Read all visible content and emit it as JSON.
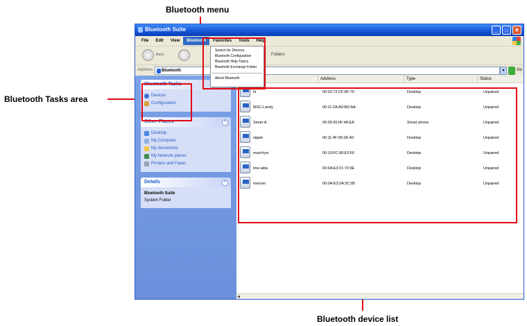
{
  "callouts": {
    "menu": "Bluetooth menu",
    "tasks": "Bluetooth Tasks area",
    "list": "Bluetooth device list"
  },
  "window": {
    "title": "Bluetooth Suite",
    "title_buttons": [
      "_",
      "□",
      "✕"
    ]
  },
  "menubar": {
    "items": [
      "File",
      "Edit",
      "View",
      "Bluetooth",
      "Favorites",
      "Tools",
      "Help"
    ],
    "active_index": 3
  },
  "toolbar": {
    "back_label": "Back",
    "folders_label": "Folders"
  },
  "address": {
    "label": "Address",
    "value": "Bluetooth",
    "go_label": "Go"
  },
  "dropdown": {
    "items": [
      "Search for Devices",
      "Bluetooth Configuration",
      "Bluetooth Help Topics",
      "Bluetooth Exchange Folder"
    ],
    "footer": "About Bluetooth"
  },
  "tasks_panel": {
    "title": "Bluetooth Tasks",
    "links": [
      "Devices",
      "Configuration"
    ]
  },
  "places_panel": {
    "title": "Other Places",
    "links": [
      "Desktop",
      "My Computer",
      "My documents",
      "My Network places",
      "Printers and Faxes"
    ]
  },
  "details_panel": {
    "title": "Details",
    "lines": [
      "Bluetooth Suite",
      "System Folder"
    ]
  },
  "list": {
    "columns": [
      "Name",
      "Address",
      "Type",
      "Status"
    ],
    "rows": [
      {
        "name": "hi",
        "address": "00:02:72:CF:8F:70",
        "type": "Desktop",
        "status": "Unpaired"
      },
      {
        "name": "MSC-Landy",
        "address": "00:11:2A:A0:BD:AA",
        "type": "Desktop",
        "status": "Unpaired"
      },
      {
        "name": "Smart A",
        "address": "00:05:95:0F:48:EA",
        "type": "Smart phone",
        "status": "Unpaired"
      },
      {
        "name": "sippie",
        "address": "00:11:4F:90:2E:A2",
        "type": "Desktop",
        "status": "Unpaired"
      },
      {
        "name": "marchysr",
        "address": "00:19:5C:90:E3:50",
        "type": "Desktop",
        "status": "Unpaired"
      },
      {
        "name": "ime-alda",
        "address": "00:0A:E3:21:70:9E",
        "type": "Desktop",
        "status": "Unpaired"
      },
      {
        "name": "mercier",
        "address": "00:0A:E3:2A:3C:80",
        "type": "Desktop",
        "status": "Unpaired"
      }
    ]
  },
  "colors": {
    "callout_red": "#e30613",
    "xp_blue": "#1452d8",
    "taskpane_blue": "#7ba2e7"
  }
}
